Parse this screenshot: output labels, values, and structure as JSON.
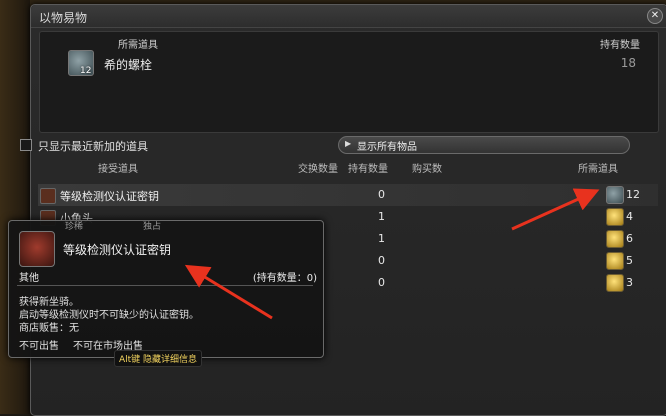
{
  "window": {
    "title": "以物易物",
    "close_glyph": "✕"
  },
  "requirement": {
    "header_item": "所需道具",
    "header_qty": "持有数量",
    "item_name": "希的螺栓",
    "icon_qty": "12",
    "owned": "18",
    "icon": "bolt-icon"
  },
  "filter": {
    "label": "只显示最近新加的道具",
    "checked": false
  },
  "show_all_button": {
    "label": "显示所有物品",
    "arrow": "▶"
  },
  "columns": {
    "receive": "接受道具",
    "exchange_qty": "交换数量",
    "have_qty": "持有数量",
    "buy_qty": "购买数",
    "cost_item": "所需道具"
  },
  "rows": [
    {
      "name": "等级检测仪认证密钥",
      "have": "0",
      "cost": "12"
    },
    {
      "name": "小龟头",
      "have": "1",
      "cost": "4"
    },
    {
      "name": "",
      "have": "1",
      "cost": "6"
    },
    {
      "name": "",
      "have": "0",
      "cost": "5"
    },
    {
      "name": "",
      "have": "0",
      "cost": "3"
    }
  ],
  "tooltip": {
    "tab_rare": "珍稀",
    "tab_unique": "独占",
    "name": "等级检测仪认证密钥",
    "category": "其他",
    "owned": "(持有数量：0)",
    "lines": [
      "获得新坐骑。",
      "启动等级检测仪时不可缺少的认证密钥。",
      "商店贩售：无"
    ],
    "flag_unsellable": "不可出售",
    "flag_no_market": "不可在市场出售",
    "hint": "Alt键 隐藏详细信息"
  },
  "colors": {
    "annotation_arrow": "#e8321e",
    "hint_text": "#f2d35e"
  }
}
